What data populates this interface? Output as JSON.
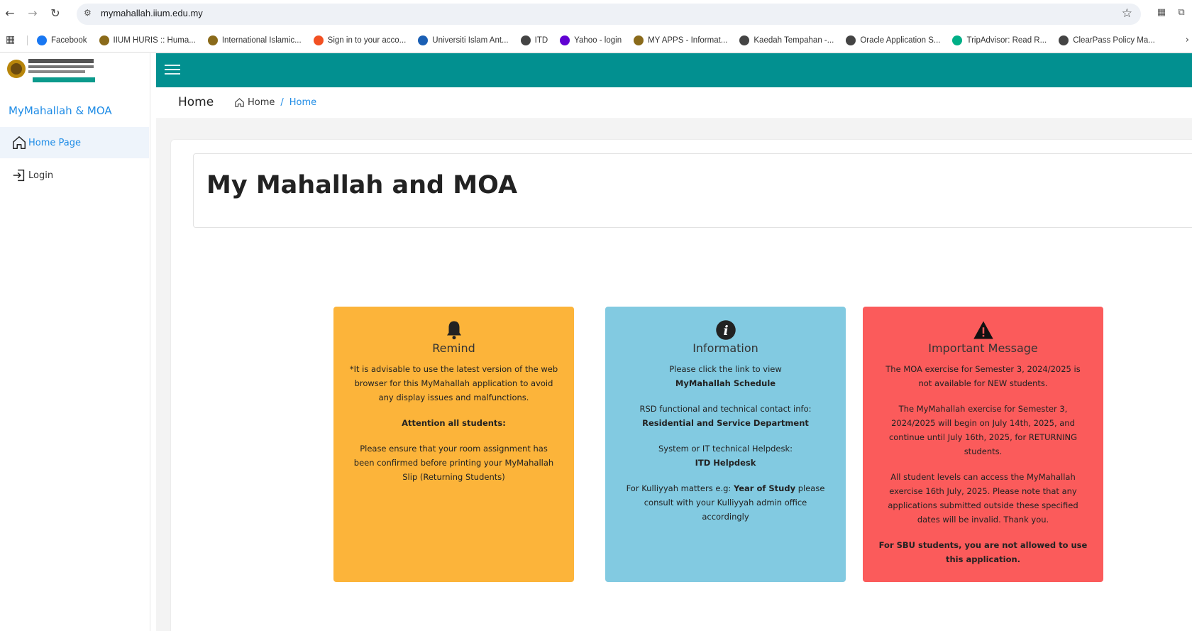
{
  "browser": {
    "url": "mymahallah.iium.edu.my",
    "bookmarks": [
      {
        "label": "Facebook",
        "color": "#1877f2"
      },
      {
        "label": "IIUM HURIS :: Huma...",
        "color": "#8a6a1a"
      },
      {
        "label": "International Islamic...",
        "color": "#8a6a1a"
      },
      {
        "label": "Sign in to your acco...",
        "color": "#f25022"
      },
      {
        "label": "Universiti Islam Ant...",
        "color": "#1a5fb4"
      },
      {
        "label": "ITD",
        "color": "#444444"
      },
      {
        "label": "Yahoo - login",
        "color": "#6001d2"
      },
      {
        "label": "MY APPS - Informat...",
        "color": "#8a6a1a"
      },
      {
        "label": "Kaedah Tempahan -...",
        "color": "#444444"
      },
      {
        "label": "Oracle Application S...",
        "color": "#444444"
      },
      {
        "label": "TripAdvisor: Read R...",
        "color": "#00af87"
      },
      {
        "label": "ClearPass Policy Ma...",
        "color": "#444444"
      }
    ]
  },
  "sidebar": {
    "brand": "MyMahallah & MOA",
    "items": [
      {
        "label": "Home Page",
        "icon": "home-icon"
      },
      {
        "label": "Login",
        "icon": "login-icon"
      }
    ]
  },
  "header": {
    "title": "Home",
    "breadcrumb": {
      "root": "Home",
      "separator": "/",
      "current": "Home"
    }
  },
  "main": {
    "title": "My Mahallah and MOA",
    "cards": {
      "remind": {
        "title": "Remind",
        "color": "#fcb43a",
        "p1": "*It is advisable to use the latest version of the web browser for this MyMahallah application to avoid any display issues and malfunctions.",
        "p2": "Attention all students:",
        "p3": "Please ensure that your room assignment has been confirmed before printing your MyMahallah Slip (Returning Students)"
      },
      "info": {
        "title": "Information",
        "color": "#82cae1",
        "p1": "Please click the link to view",
        "p1_bold": "MyMahallah Schedule",
        "p2": "RSD functional and technical contact info:",
        "p2_bold": "Residential and Service Department",
        "p3": "System or IT technical Helpdesk:",
        "p3_bold": "ITD Helpdesk",
        "p4_pre": "For Kulliyyah matters e.g: ",
        "p4_bold": "Year of Study",
        "p4_post": " please consult with your Kulliyyah admin office accordingly"
      },
      "important": {
        "title": "Important Message",
        "color": "#fb5b5b",
        "p1": "The MOA exercise for Semester 3, 2024/2025 is not available for NEW students.",
        "p2": "The MyMahallah exercise for Semester 3, 2024/2025 will begin on July 14th, 2025, and continue until July 16th, 2025, for RETURNING students.",
        "p3": "All student levels can access the MyMahallah exercise 16th July, 2025. Please note that any applications submitted outside these specified dates will be invalid. Thank you.",
        "p4": "For SBU students, you are not allowed to use this application."
      }
    }
  }
}
